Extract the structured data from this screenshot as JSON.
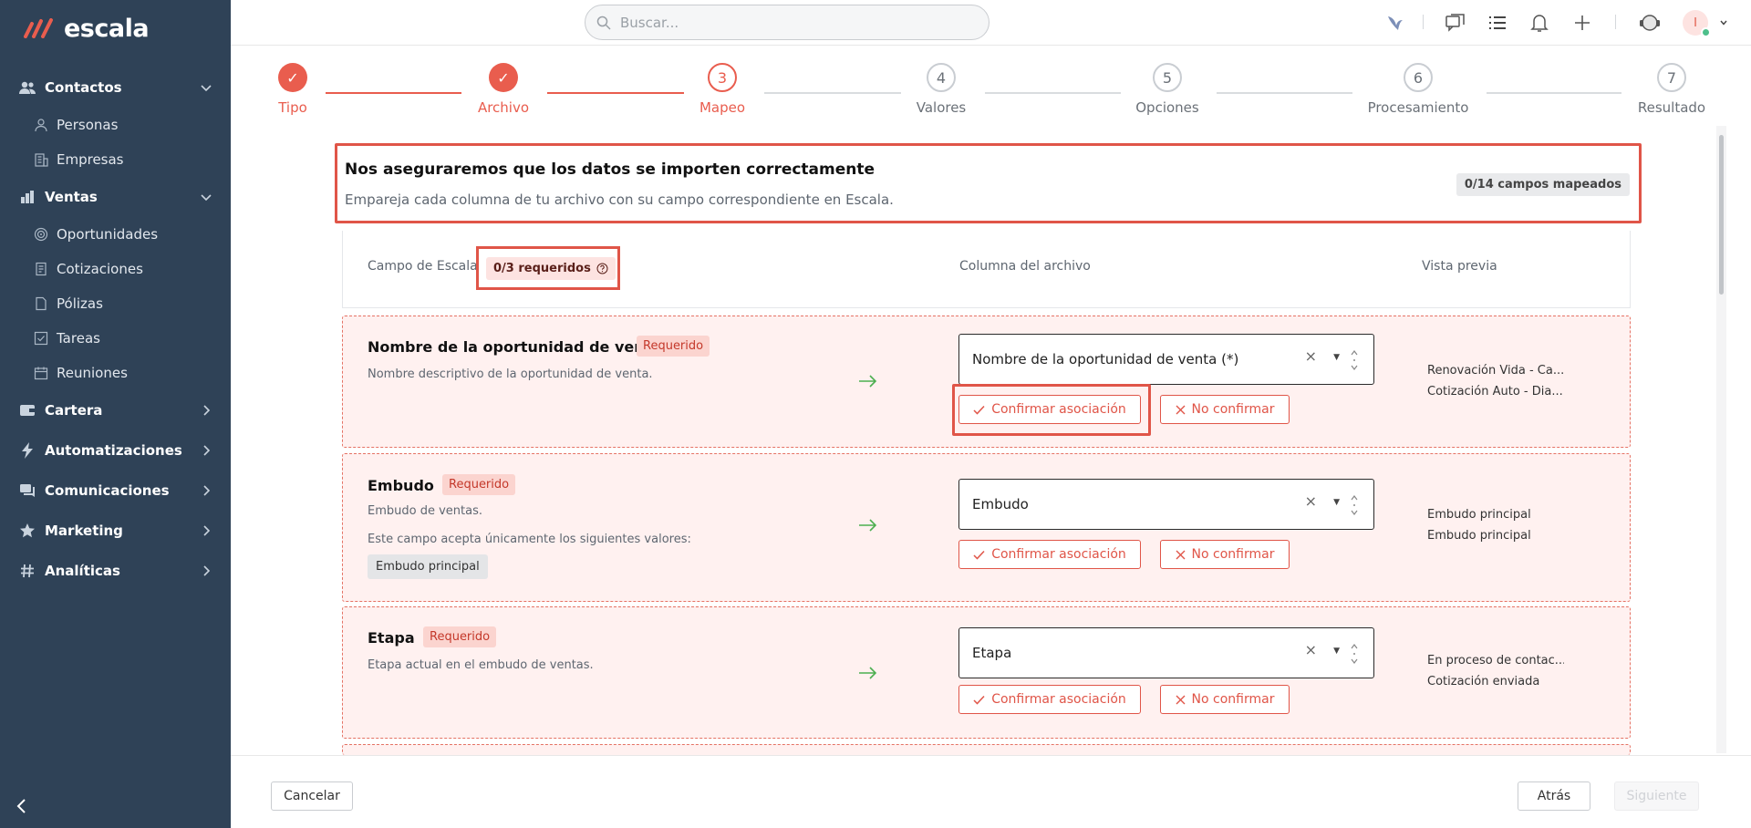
{
  "brand": {
    "name": "escala",
    "accent": "#e95d4e",
    "sidebar_bg": "#2f4257"
  },
  "sidebar": {
    "sections": [
      {
        "label": "Contactos",
        "icon": "contacts-icon",
        "expanded": true,
        "items": [
          {
            "label": "Personas",
            "icon": "person-icon"
          },
          {
            "label": "Empresas",
            "icon": "building-icon"
          }
        ]
      },
      {
        "label": "Ventas",
        "icon": "sales-icon",
        "expanded": true,
        "items": [
          {
            "label": "Oportunidades",
            "icon": "target-icon"
          },
          {
            "label": "Cotizaciones",
            "icon": "document-icon"
          },
          {
            "label": "Pólizas",
            "icon": "file-icon"
          },
          {
            "label": "Tareas",
            "icon": "checkbox-icon"
          },
          {
            "label": "Reuniones",
            "icon": "calendar-icon"
          }
        ]
      },
      {
        "label": "Cartera",
        "icon": "wallet-icon",
        "expanded": false
      },
      {
        "label": "Automatizaciones",
        "icon": "lightning-icon",
        "expanded": false
      },
      {
        "label": "Comunicaciones",
        "icon": "chat-icon",
        "expanded": false
      },
      {
        "label": "Marketing",
        "icon": "star-icon",
        "expanded": false
      },
      {
        "label": "Analíticas",
        "icon": "hash-icon",
        "expanded": false
      }
    ]
  },
  "topbar": {
    "search_placeholder": "Buscar...",
    "avatar_initial": "I"
  },
  "stepper": {
    "steps": [
      {
        "num": "✓",
        "label": "Tipo",
        "state": "done"
      },
      {
        "num": "✓",
        "label": "Archivo",
        "state": "done"
      },
      {
        "num": "3",
        "label": "Mapeo",
        "state": "current"
      },
      {
        "num": "4",
        "label": "Valores",
        "state": "todo"
      },
      {
        "num": "5",
        "label": "Opciones",
        "state": "todo"
      },
      {
        "num": "6",
        "label": "Procesamiento",
        "state": "todo"
      },
      {
        "num": "7",
        "label": "Resultado",
        "state": "todo"
      }
    ]
  },
  "info": {
    "title": "Nos aseguraremos que los datos se importen correctamente",
    "description": "Empareja cada columna de tu archivo con su campo correspondiente en Escala.",
    "badge": "0/14 campos mapeados"
  },
  "table": {
    "col_field": "Campo de Escala",
    "required_badge": "0/3 requeridos",
    "col_file": "Columna del archivo",
    "col_preview": "Vista previa"
  },
  "rows": [
    {
      "name": "Nombre de la oportunidad de venta",
      "required": "Requerido",
      "description": "Nombre descriptivo de la oportunidad de venta.",
      "selected": "Nombre de la oportunidad de venta (*)",
      "confirm": "Confirmar asociación",
      "reject": "No confirmar",
      "preview": [
        "Renovación Vida - Ca...",
        "Cotización Auto - Dia..."
      ]
    },
    {
      "name": "Embudo",
      "required": "Requerido",
      "description": "Embudo de ventas.",
      "note": "Este campo acepta únicamente los siguientes valores:",
      "chip": "Embudo principal",
      "selected": "Embudo",
      "confirm": "Confirmar asociación",
      "reject": "No confirmar",
      "preview": [
        "Embudo principal",
        "Embudo principal"
      ]
    },
    {
      "name": "Etapa",
      "required": "Requerido",
      "description": "Etapa actual en el embudo de ventas.",
      "selected": "Etapa",
      "confirm": "Confirmar asociación",
      "reject": "No confirmar",
      "preview": [
        "En proceso de contac...",
        "Cotización enviada"
      ]
    }
  ],
  "footer": {
    "cancel": "Cancelar",
    "back": "Atrás",
    "next": "Siguiente"
  }
}
